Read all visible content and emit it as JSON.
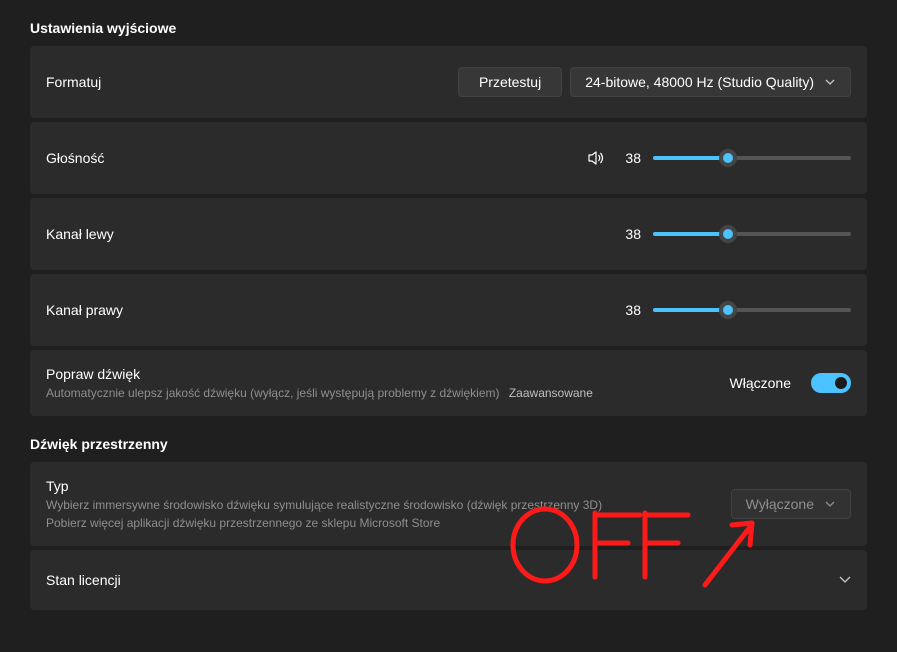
{
  "output_settings": {
    "header": "Ustawienia wyjściowe",
    "format": {
      "label": "Formatuj",
      "test_button": "Przetestuj",
      "dropdown_value": "24-bitowe, 48000 Hz (Studio Quality)"
    },
    "volume": {
      "label": "Głośność",
      "value": "38",
      "percent": 38
    },
    "left_channel": {
      "label": "Kanał lewy",
      "value": "38",
      "percent": 38
    },
    "right_channel": {
      "label": "Kanał prawy",
      "value": "38",
      "percent": 38
    },
    "enhance": {
      "title": "Popraw dźwięk",
      "subtitle": "Automatycznie ulepsz jakość dźwięku (wyłącz, jeśli występują problemy z dźwiękiem)",
      "advanced_link": "Zaawansowane",
      "state_label": "Włączone"
    }
  },
  "spatial_sound": {
    "header": "Dźwięk przestrzenny",
    "type": {
      "title": "Typ",
      "subtitle1": "Wybierz immersywne środowisko dźwięku symulujące realistyczne środowisko (dźwięk przestrzenny 3D)",
      "subtitle2": "Pobierz więcej aplikacji dźwięku przestrzennego ze sklepu Microsoft Store",
      "dropdown_value": "Wyłączone"
    },
    "license": {
      "title": "Stan licencji"
    }
  },
  "annotation_text": "OFF"
}
